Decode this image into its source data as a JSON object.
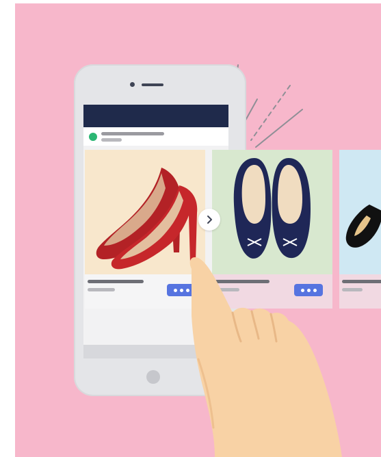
{
  "scene": {
    "background_color": "#f7b7cb",
    "phone_frame_color": "#e4e5e8",
    "status_bar_color": "#1f2a4b",
    "accent_button_color": "#5674e0",
    "online_dot_color": "#2bb673"
  },
  "carousel": {
    "cards": [
      {
        "product": "red-high-heels",
        "background": "#f8e7cc"
      },
      {
        "product": "navy-ballet-flats",
        "background": "#d8e8cf"
      },
      {
        "product": "black-shoe",
        "background": "#cfe8f3"
      }
    ],
    "next_icon": "chevron-right-icon",
    "more_icon": "more-dots-icon"
  },
  "gesture": {
    "icon": "swipe-hand-icon"
  }
}
